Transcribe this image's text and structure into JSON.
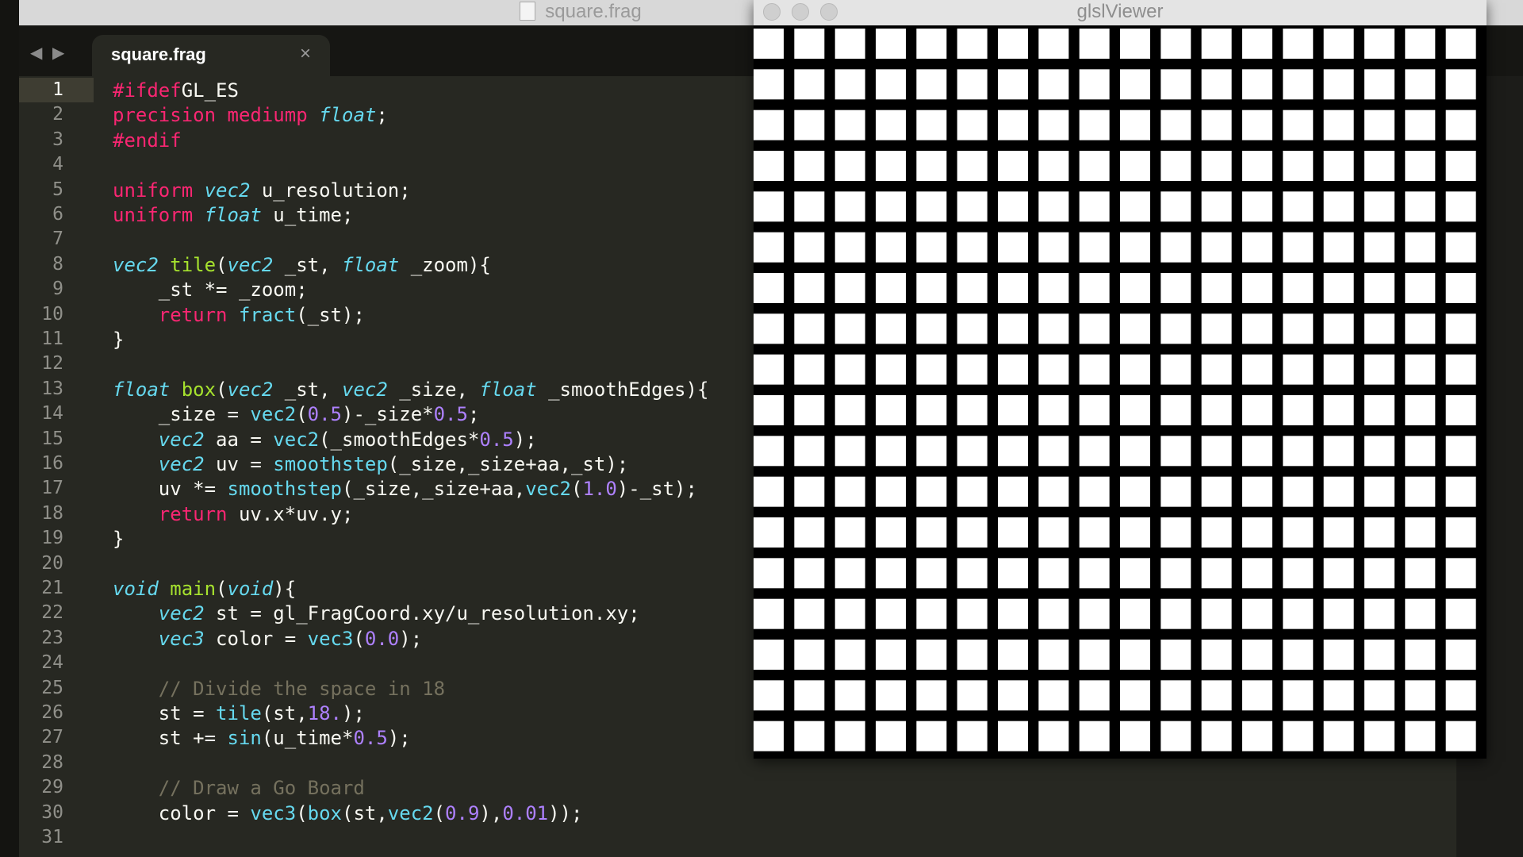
{
  "editor": {
    "window_title": "square.frag",
    "tab": {
      "label": "square.frag",
      "close_icon": "×"
    },
    "nav": {
      "back": "◀",
      "forward": "▶"
    },
    "active_line": 1,
    "lines": [
      [
        [
          "kw",
          "#ifdef"
        ],
        [
          "",
          "GL_ES"
        ]
      ],
      [
        [
          "kw",
          "precision"
        ],
        [
          "",
          ""
        ],
        [
          "kw",
          "mediump"
        ],
        [
          "",
          ""
        ],
        [
          "ty",
          "float"
        ],
        [
          "",
          ";"
        ]
      ],
      [
        [
          "kw",
          "#endif"
        ]
      ],
      [],
      [
        [
          "kw",
          "uniform"
        ],
        [
          "",
          " "
        ],
        [
          "ty",
          "vec2"
        ],
        [
          "",
          " u_resolution;"
        ]
      ],
      [
        [
          "kw",
          "uniform"
        ],
        [
          "",
          " "
        ],
        [
          "ty",
          "float"
        ],
        [
          "",
          " u_time;"
        ]
      ],
      [],
      [
        [
          "ty",
          "vec2"
        ],
        [
          "",
          " "
        ],
        [
          "fn",
          "tile"
        ],
        [
          "",
          "("
        ],
        [
          "ty",
          "vec2"
        ],
        [
          "",
          " _st, "
        ],
        [
          "ty",
          "float"
        ],
        [
          "",
          " _zoom){"
        ]
      ],
      [
        [
          "",
          "    _st *= _zoom;"
        ]
      ],
      [
        [
          "",
          "    "
        ],
        [
          "kw",
          "return"
        ],
        [
          "",
          " "
        ],
        [
          "bi",
          "fract"
        ],
        [
          "",
          "(_st);"
        ]
      ],
      [
        [
          "",
          "}"
        ]
      ],
      [],
      [
        [
          "ty",
          "float"
        ],
        [
          "",
          " "
        ],
        [
          "fn",
          "box"
        ],
        [
          "",
          "("
        ],
        [
          "ty",
          "vec2"
        ],
        [
          "",
          " _st, "
        ],
        [
          "ty",
          "vec2"
        ],
        [
          "",
          " _size, "
        ],
        [
          "ty",
          "float"
        ],
        [
          "",
          " _smoothEdges){"
        ]
      ],
      [
        [
          "",
          "    _size = "
        ],
        [
          "bi",
          "vec2"
        ],
        [
          "",
          "("
        ],
        [
          "nu",
          "0.5"
        ],
        [
          "",
          ")-_size*"
        ],
        [
          "nu",
          "0.5"
        ],
        [
          "",
          ";"
        ]
      ],
      [
        [
          "",
          "    "
        ],
        [
          "ty",
          "vec2"
        ],
        [
          "",
          " aa = "
        ],
        [
          "bi",
          "vec2"
        ],
        [
          "",
          "(_smoothEdges*"
        ],
        [
          "nu",
          "0.5"
        ],
        [
          "",
          ");"
        ]
      ],
      [
        [
          "",
          "    "
        ],
        [
          "ty",
          "vec2"
        ],
        [
          "",
          " uv = "
        ],
        [
          "bi",
          "smoothstep"
        ],
        [
          "",
          "(_size,_size+aa,_st);"
        ]
      ],
      [
        [
          "",
          "    uv *= "
        ],
        [
          "bi",
          "smoothstep"
        ],
        [
          "",
          "(_size,_size+aa,"
        ],
        [
          "bi",
          "vec2"
        ],
        [
          "",
          "("
        ],
        [
          "nu",
          "1.0"
        ],
        [
          "",
          ")-_st);"
        ]
      ],
      [
        [
          "",
          "    "
        ],
        [
          "kw",
          "return"
        ],
        [
          "",
          " uv.x*uv.y;"
        ]
      ],
      [
        [
          "",
          "}"
        ]
      ],
      [],
      [
        [
          "ty",
          "void"
        ],
        [
          "",
          " "
        ],
        [
          "fn",
          "main"
        ],
        [
          "",
          "("
        ],
        [
          "ty",
          "void"
        ],
        [
          "",
          "){"
        ]
      ],
      [
        [
          "",
          "    "
        ],
        [
          "ty",
          "vec2"
        ],
        [
          "",
          " st = gl_FragCoord.xy/u_resolution.xy;"
        ]
      ],
      [
        [
          "",
          "    "
        ],
        [
          "ty",
          "vec3"
        ],
        [
          "",
          " color = "
        ],
        [
          "bi",
          "vec3"
        ],
        [
          "",
          "("
        ],
        [
          "nu",
          "0.0"
        ],
        [
          "",
          ");"
        ]
      ],
      [],
      [
        [
          "",
          "    "
        ],
        [
          "cm",
          "// Divide the space in 18"
        ]
      ],
      [
        [
          "",
          "    st = "
        ],
        [
          "bi",
          "tile"
        ],
        [
          "",
          "(st,"
        ],
        [
          "nu",
          "18."
        ],
        [
          "",
          ");"
        ]
      ],
      [
        [
          "",
          "    st += "
        ],
        [
          "bi",
          "sin"
        ],
        [
          "",
          "(u_time*"
        ],
        [
          "nu",
          "0.5"
        ],
        [
          "",
          ");"
        ]
      ],
      [],
      [
        [
          "",
          "    "
        ],
        [
          "cm",
          "// Draw a Go Board"
        ]
      ],
      [
        [
          "",
          "    color = "
        ],
        [
          "bi",
          "vec3"
        ],
        [
          "",
          "("
        ],
        [
          "bi",
          "box"
        ],
        [
          "",
          "(st,"
        ],
        [
          "bi",
          "vec2"
        ],
        [
          "",
          "("
        ],
        [
          "nu",
          "0.9"
        ],
        [
          "",
          "),"
        ],
        [
          "nu",
          "0.01"
        ],
        [
          "",
          "));"
        ]
      ],
      []
    ]
  },
  "viewer": {
    "window_title": "glslViewer",
    "grid": {
      "columns": 18,
      "rows": 18,
      "square_fill": 0.74,
      "square_color": "#ffffff",
      "background": "#000000"
    }
  },
  "colors": {
    "editor_bg": "#272822",
    "keyword": "#f92672",
    "type": "#66d9ef",
    "function": "#a6e22e",
    "number": "#ae81ff",
    "comment": "#75715e"
  }
}
